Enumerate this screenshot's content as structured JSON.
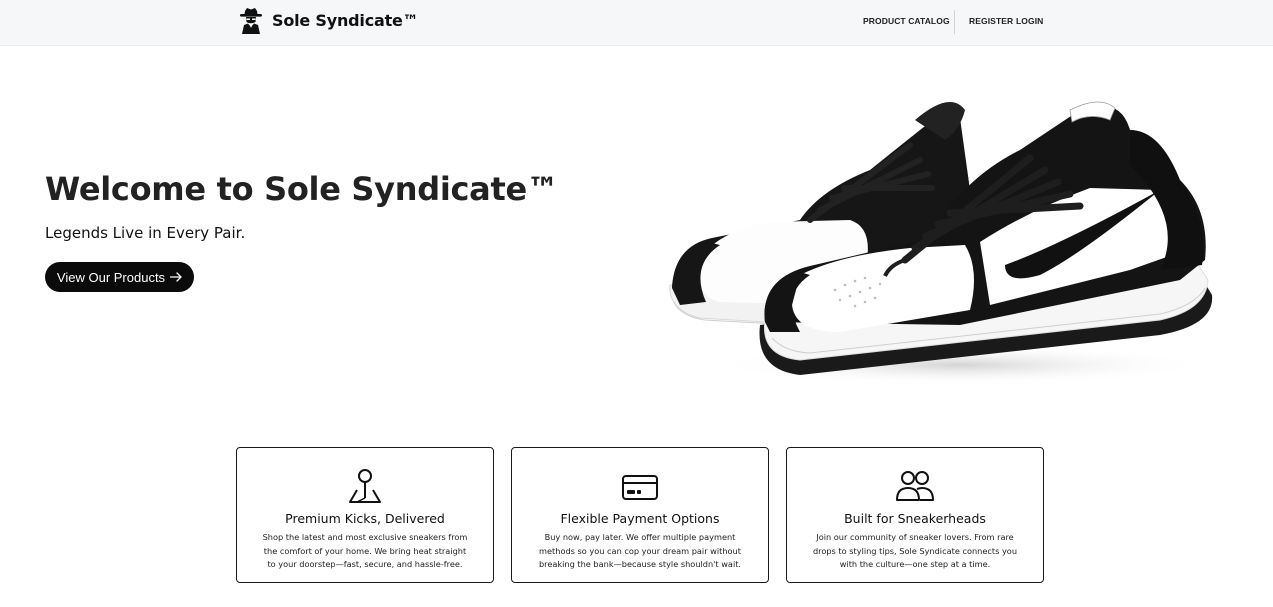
{
  "nav": {
    "brand": "Sole Syndicate™",
    "product_catalog": "PRODUCT CATALOG",
    "register": "REGISTER",
    "login": "LOGIN"
  },
  "hero": {
    "title": "Welcome to Sole Syndicate™",
    "subtitle": "Legends Live in Every Pair.",
    "cta_label": "View Our Products",
    "image_icon": "sneaker-image"
  },
  "features": [
    {
      "icon": "map-pin-icon",
      "title": "Premium Kicks, Delivered",
      "text": "Shop the latest and most exclusive sneakers from the comfort of your home. We bring heat straight to your doorstep—fast, secure, and hassle-free."
    },
    {
      "icon": "credit-card-icon",
      "title": "Flexible Payment Options",
      "text": "Buy now, pay later. We offer multiple payment methods so you can cop your dream pair without breaking the bank—because style shouldn't wait."
    },
    {
      "icon": "people-icon",
      "title": "Built for Sneakerheads",
      "text": "Join our community of sneaker lovers. From rare drops to styling tips, Sole Syndicate connects you with the culture—one step at a time."
    }
  ],
  "colors": {
    "navbar_bg": "#f6f7f8",
    "accent": "#0b0b0b",
    "text": "#1f1f1f"
  }
}
